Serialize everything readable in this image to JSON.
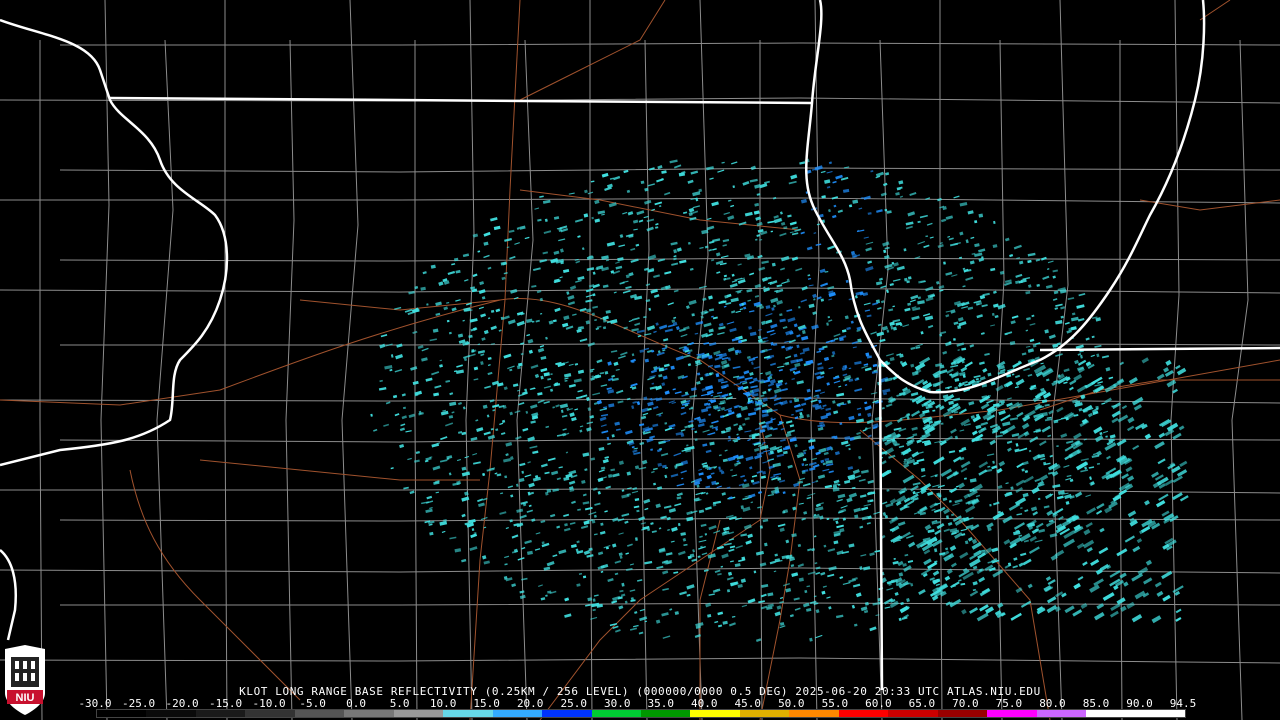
{
  "product": {
    "title_line": "KLOT LONG RANGE BASE REFLECTIVITY (0.25KM / 256 LEVEL) (000000/0000 0.5 DEG) 2025-06-20 20:33 UTC  ATLAS.NIU.EDU"
  },
  "logo": {
    "text": "NIU",
    "icon": "niu-castle-logo-icon"
  },
  "legend": {
    "labels": [
      "-30.0",
      "-25.0",
      "-20.0",
      "-15.0",
      "-10.0",
      "-5.0",
      "0.0",
      "5.0",
      "10.0",
      "15.0",
      "20.0",
      "25.0",
      "30.0",
      "35.0",
      "40.0",
      "45.0",
      "50.0",
      "55.0",
      "60.0",
      "65.0",
      "70.0",
      "75.0",
      "80.0",
      "85.0",
      "90.0",
      "94.5"
    ],
    "colors": [
      "#000000",
      "#0a0a0a",
      "#1a1a1a",
      "#333333",
      "#555555",
      "#777777",
      "#999999",
      "#66d8e8",
      "#33aaff",
      "#0033ff",
      "#00cc33",
      "#009900",
      "#ffff00",
      "#e0b000",
      "#ff8800",
      "#ff0000",
      "#cc0000",
      "#990000",
      "#ff00ff",
      "#cc66ff",
      "#ffffff",
      "#ffffff"
    ]
  },
  "colors": {
    "background": "#000000",
    "state_border": "#ffffff",
    "county_border": "#9a9a9a",
    "highway": "#a0522d",
    "echo_light": "#40e0e0",
    "echo_mid": "#1e90ff"
  }
}
